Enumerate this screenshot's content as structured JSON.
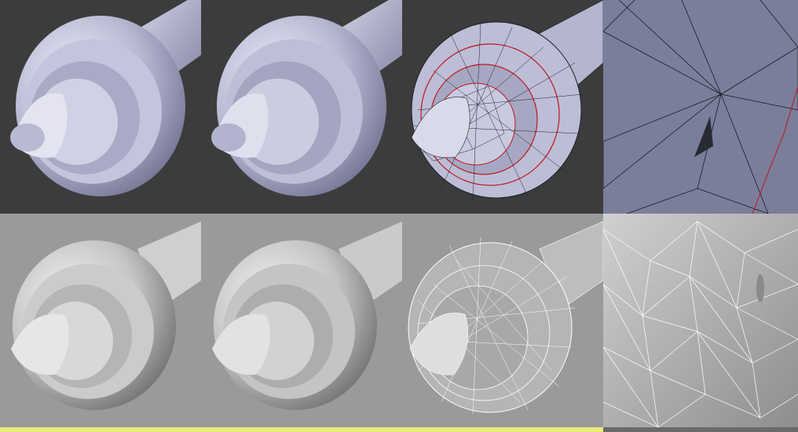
{
  "grid": {
    "rows": 2,
    "cols": 4,
    "top_row_background": "#3c3c3c",
    "bottom_row_background": "#9a9a9a",
    "top_model_color": "#b8bad2",
    "bottom_model_color": "#c8c8c8",
    "wire_dark": "#1e1e28",
    "wire_seam": "#c0141c",
    "wire_white": "#ffffff",
    "accent_strip": "#e8ec7a"
  },
  "panels": [
    {
      "row": 0,
      "col": 0,
      "content": "smooth-shaded-connector-blue"
    },
    {
      "row": 0,
      "col": 1,
      "content": "flat-shaded-connector-blue"
    },
    {
      "row": 0,
      "col": 2,
      "content": "wireframe-connector-seams"
    },
    {
      "row": 0,
      "col": 3,
      "content": "closeup-wireframe-hole"
    },
    {
      "row": 1,
      "col": 0,
      "content": "smooth-shaded-connector-grey"
    },
    {
      "row": 1,
      "col": 1,
      "content": "flat-shaded-connector-grey"
    },
    {
      "row": 1,
      "col": 2,
      "content": "white-wireframe-connector"
    },
    {
      "row": 1,
      "col": 3,
      "content": "closeup-white-wireframe"
    }
  ]
}
